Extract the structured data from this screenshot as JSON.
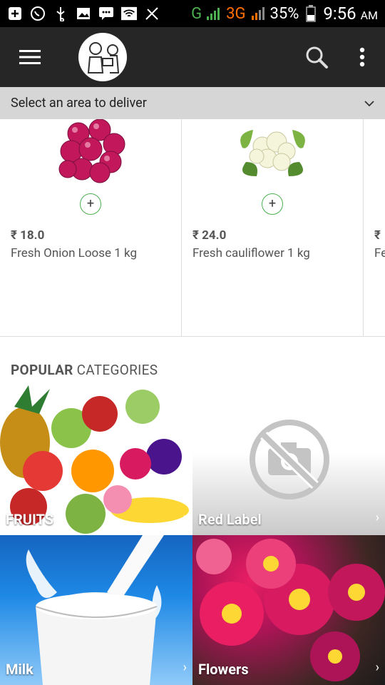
{
  "status_bar": {
    "network": "G",
    "network_3g": "3G",
    "battery_pct": "35%",
    "time": "9:56",
    "ampm": "AM"
  },
  "toolbar": {
    "icons": [
      "menu-icon",
      "logo",
      "search-icon",
      "overflow-icon"
    ]
  },
  "area_select": {
    "label": "Select an area to deliver"
  },
  "products": [
    {
      "price": "₹ 18.0",
      "name": "Fresh Onion Loose 1 kg",
      "add": "+"
    },
    {
      "price": "₹ 24.0",
      "name": "Fresh cauliflower 1 kg",
      "add": "+"
    },
    {
      "price": "₹",
      "name": "Fe Ca",
      "add": "+"
    }
  ],
  "popular": {
    "bold": "POPULAR",
    "rest": " CATEGORIES"
  },
  "categories": [
    {
      "label": "FRUITS",
      "chev": "›"
    },
    {
      "label": "Red Label",
      "chev": "›"
    },
    {
      "label": "Milk",
      "chev": "›"
    },
    {
      "label": "Flowers",
      "chev": "›"
    }
  ],
  "colors": {
    "toolbar": "#262626",
    "area_bar": "#d6d6d6",
    "accent_green": "#4caf50"
  }
}
